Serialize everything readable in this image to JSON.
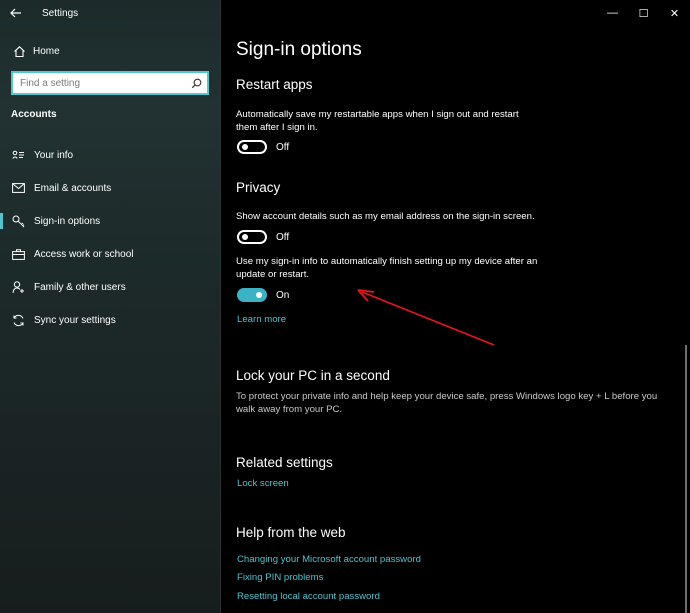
{
  "window": {
    "title": "Settings",
    "back_icon": "arrow-left-icon",
    "controls": {
      "minimize": "—",
      "maximize": "☐",
      "close": "✕"
    }
  },
  "sidebar": {
    "home_label": "Home",
    "search_placeholder": "Find a setting",
    "section_label": "Accounts",
    "items": [
      {
        "label": "Your info",
        "icon": "person-card-icon"
      },
      {
        "label": "Email & accounts",
        "icon": "mail-icon"
      },
      {
        "label": "Sign-in options",
        "icon": "key-icon",
        "active": true
      },
      {
        "label": "Access work or school",
        "icon": "briefcase-icon"
      },
      {
        "label": "Family & other users",
        "icon": "person-add-icon"
      },
      {
        "label": "Sync your settings",
        "icon": "sync-icon"
      }
    ],
    "accent_color": "#4fc3cf"
  },
  "main": {
    "title": "Sign-in options",
    "restart_apps": {
      "heading": "Restart apps",
      "description": "Automatically save my restartable apps when I sign out and restart them after I sign in.",
      "toggle_state": "Off"
    },
    "privacy": {
      "heading": "Privacy",
      "account_details": {
        "description": "Show account details such as my email address on the sign-in screen.",
        "toggle_state": "Off"
      },
      "sign_in_info": {
        "description": "Use my sign-in info to automatically finish setting up my device after an update or restart.",
        "toggle_state": "On"
      },
      "learn_more": "Learn more"
    },
    "lock_pc": {
      "heading": "Lock your PC in a second",
      "description": "To protect your private info and help keep your device safe, press Windows logo key + L before you walk away from your PC."
    },
    "related": {
      "heading": "Related settings",
      "link": "Lock screen"
    },
    "help": {
      "heading": "Help from the web",
      "links": [
        "Changing your Microsoft account password",
        "Fixing PIN problems",
        "Resetting local account password"
      ]
    }
  },
  "annotation": {
    "arrow_color": "#e8141e"
  }
}
